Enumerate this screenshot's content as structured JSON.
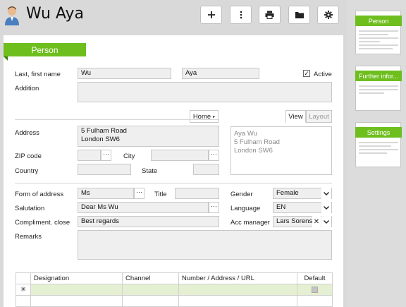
{
  "header": {
    "title": "Wu Aya"
  },
  "section_tab": "Person",
  "form": {
    "last_first_label": "Last, first name",
    "last_name": "Wu",
    "first_name": "Aya",
    "active_label": "Active",
    "active_checked": true,
    "addition_label": "Addition",
    "address_type": "Home",
    "view_tab": "View",
    "layout_tab": "Layout",
    "address_label": "Address",
    "address_value": "5 Fulham Road\nLondon SW6",
    "preview_text": "Aya Wu\n5 Fulham Road\nLondon SW6",
    "zip_label": "ZIP code",
    "city_label": "City",
    "country_label": "Country",
    "state_label": "State",
    "form_of_address_label": "Form of address",
    "form_of_address": "Ms",
    "title_label": "Title",
    "gender_label": "Gender",
    "gender": "Female",
    "salutation_label": "Salutation",
    "salutation": "Dear Ms Wu",
    "language_label": "Language",
    "language": "EN",
    "complimentary_label": "Compliment. close",
    "complimentary": "Best regards",
    "acc_manager_label": "Acc manager",
    "acc_manager": "Lars Sorensen",
    "remarks_label": "Remarks",
    "dots": "···"
  },
  "grid": {
    "columns": [
      "Designation",
      "Channel",
      "Number / Address / URL",
      "Default"
    ],
    "new_row_marker": "✳"
  },
  "side": {
    "thumbs": [
      "Person",
      "Further infor...",
      "Settings"
    ]
  }
}
